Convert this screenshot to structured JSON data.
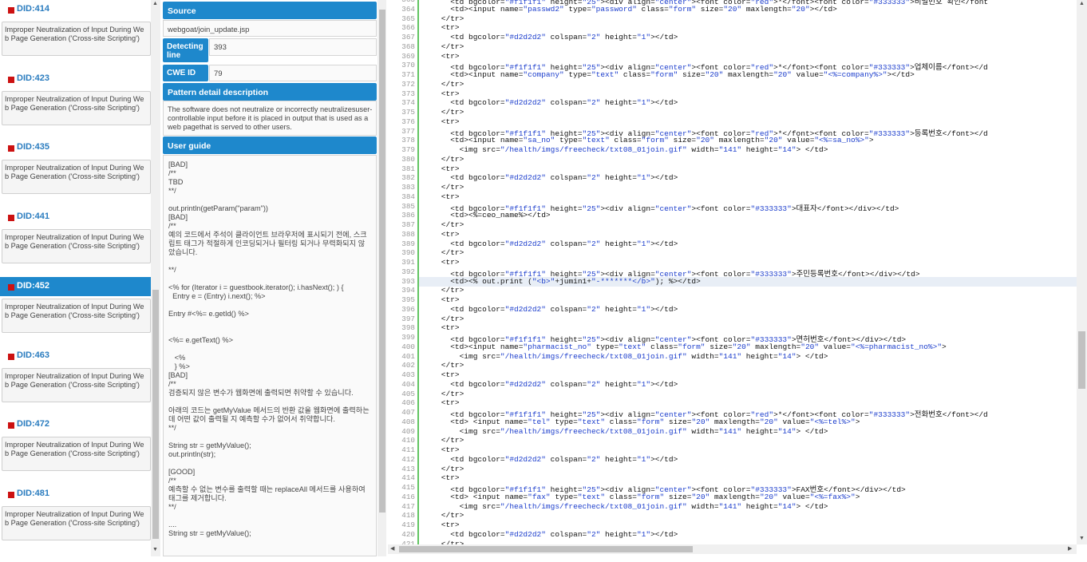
{
  "issues": [
    {
      "id": "DID:414",
      "text": "Improper Neutralization of Input During Web Page Generation ('Cross-site Scripting')",
      "selected": false
    },
    {
      "id": "DID:423",
      "text": "Improper Neutralization of Input During Web Page Generation ('Cross-site Scripting')",
      "selected": false
    },
    {
      "id": "DID:435",
      "text": "Improper Neutralization of Input During Web Page Generation ('Cross-site Scripting')",
      "selected": false
    },
    {
      "id": "DID:441",
      "text": "Improper Neutralization of Input During Web Page Generation ('Cross-site Scripting')",
      "selected": false
    },
    {
      "id": "DID:452",
      "text": "Improper Neutralization of Input During Web Page Generation ('Cross-site Scripting')",
      "selected": true
    },
    {
      "id": "DID:463",
      "text": "Improper Neutralization of Input During Web Page Generation ('Cross-site Scripting')",
      "selected": false
    },
    {
      "id": "DID:472",
      "text": "Improper Neutralization of Input During Web Page Generation ('Cross-site Scripting')",
      "selected": false
    },
    {
      "id": "DID:481",
      "text": "Improper Neutralization of Input During Web Page Generation ('Cross-site Scripting')",
      "selected": false
    }
  ],
  "detail": {
    "source_label": "Source",
    "source_value": "webgoat/join_update.jsp",
    "detecting_line_label": "Detecting line",
    "detecting_line_value": "393",
    "cwe_label": "CWE ID",
    "cwe_value": "79",
    "pattern_label": "Pattern detail description",
    "pattern_text": "The software does not neutralize or incorrectly neutralizesuser-controllable input before it is placed in output that is used as a web pagethat is served to other users.",
    "guide_label": "User guide",
    "guide_text": "[BAD]\n/**\nTBD\n**/\n\nout.println(getParam(\"param\"))\n[BAD]\n/**\n예의 코드에서 주석이 클라이언트 브라우저에 표시되기 전에, 스크립트 태그가 적절하게 인코딩되거나 필터링 되거나 무력화되지 않았습니다.\n\n**/\n\n<% for (Iterator i = guestbook.iterator(); i.hasNext(); ) {\n  Entry e = (Entry) i.next(); %>\n\nEntry #<%= e.getId() %>\n\n\n<%= e.getText() %>\n\n   <%\n   } %>\n[BAD]\n/**\n검증되지 않은 변수가 웹화면에 출력되면 취약할 수 있습니다.\n\n아래의 코드는 getMyValue 메서드의 반환 값을 웹화면에 출력하는데 어떤 값이 출력될 지 예측할 수가 없어서 취약합니다.\n**/\n\nString str = getMyValue();\nout.println(str);\n\n[GOOD]\n/**\n예측할 수 없는 변수를 출력할 때는 replaceAll 메서드를 사용하여 태그를 제거합니다.\n**/\n\n....\nString str = getMyValue();"
  },
  "editor": {
    "highlight_line": 393,
    "lines": [
      {
        "n": "363",
        "t": "      <td bgcolor=\"#f1f1f1\" height=\"25\"><div align=\"center\"><font color=\"red\">*</font><font color=\"#333333\">비밀번호 확인</font"
      },
      {
        "n": "364",
        "t": "      <td><input name=\"passwd2\" type=\"password\" class=\"form\" size=\"20\" maxlength=\"20\"></td>"
      },
      {
        "n": "365",
        "t": "    </tr>"
      },
      {
        "n": "366",
        "t": "    <tr>"
      },
      {
        "n": "367",
        "t": "      <td bgcolor=\"#d2d2d2\" colspan=\"2\" height=\"1\"></td>"
      },
      {
        "n": "368",
        "t": "    </tr>"
      },
      {
        "n": "369",
        "t": "    <tr>"
      },
      {
        "n": "370",
        "t": "      <td bgcolor=\"#f1f1f1\" height=\"25\"><div align=\"center\"><font color=\"red\">*</font><font color=\"#333333\">업체이름</font></d"
      },
      {
        "n": "371",
        "t": "      <td><input name=\"company\" type=\"text\" class=\"form\" size=\"20\" maxlength=\"20\" value=\"<%=company%>\"></td>"
      },
      {
        "n": "372",
        "t": "    </tr>"
      },
      {
        "n": "373",
        "t": "    <tr>"
      },
      {
        "n": "374",
        "t": "      <td bgcolor=\"#d2d2d2\" colspan=\"2\" height=\"1\"></td>"
      },
      {
        "n": "375",
        "t": "    </tr>"
      },
      {
        "n": "376",
        "t": "    <tr>"
      },
      {
        "n": "377",
        "t": "      <td bgcolor=\"#f1f1f1\" height=\"25\"><div align=\"center\"><font color=\"red\">*</font><font color=\"#333333\">등록번호</font></d"
      },
      {
        "n": "378",
        "t": "      <td><input name=\"sa_no\" type=\"text\" class=\"form\" size=\"20\" maxlength=\"20\" value=\"<%=sa_no%>\">"
      },
      {
        "n": "379",
        "t": "        <img src=\"/health/imgs/freecheck/txt08_01join.gif\" width=\"141\" height=\"14\"> </td>"
      },
      {
        "n": "380",
        "t": "    </tr>"
      },
      {
        "n": "381",
        "t": "    <tr>"
      },
      {
        "n": "382",
        "t": "      <td bgcolor=\"#d2d2d2\" colspan=\"2\" height=\"1\"></td>"
      },
      {
        "n": "383",
        "t": "    </tr>"
      },
      {
        "n": "384",
        "t": "    <tr>"
      },
      {
        "n": "385",
        "t": "      <td bgcolor=\"#f1f1f1\" height=\"25\"><div align=\"center\"><font color=\"#333333\">대표자</font></div></td>"
      },
      {
        "n": "386",
        "t": "      <td><%=ceo_name%></td>"
      },
      {
        "n": "387",
        "t": "    </tr>"
      },
      {
        "n": "388",
        "t": "    <tr>"
      },
      {
        "n": "389",
        "t": "      <td bgcolor=\"#d2d2d2\" colspan=\"2\" height=\"1\"></td>"
      },
      {
        "n": "390",
        "t": "    </tr>"
      },
      {
        "n": "391",
        "t": "    <tr>"
      },
      {
        "n": "392",
        "t": "      <td bgcolor=\"#f1f1f1\" height=\"25\"><div align=\"center\"><font color=\"#333333\">주민등록번호</font></div></td>"
      },
      {
        "n": "393",
        "t": "      <td><% out.print (\"<b>\"+jumin1+\"-*******</b>\"); %></td>"
      },
      {
        "n": "394",
        "t": "    </tr>"
      },
      {
        "n": "395",
        "t": "    <tr>"
      },
      {
        "n": "396",
        "t": "      <td bgcolor=\"#d2d2d2\" colspan=\"2\" height=\"1\"></td>"
      },
      {
        "n": "397",
        "t": "    </tr>"
      },
      {
        "n": "398",
        "t": "    <tr>"
      },
      {
        "n": "399",
        "t": "      <td bgcolor=\"#f1f1f1\" height=\"25\"><div align=\"center\"><font color=\"#333333\">면허번호</font></div></td>"
      },
      {
        "n": "400",
        "t": "      <td><input name=\"pharmacist_no\" type=\"text\" class=\"form\" size=\"20\" maxlength=\"20\" value=\"<%=pharmacist_no%>\">"
      },
      {
        "n": "401",
        "t": "        <img src=\"/health/imgs/freecheck/txt08_01join.gif\" width=\"141\" height=\"14\"> </td>"
      },
      {
        "n": "402",
        "t": "    </tr>"
      },
      {
        "n": "403",
        "t": "    <tr>"
      },
      {
        "n": "404",
        "t": "      <td bgcolor=\"#d2d2d2\" colspan=\"2\" height=\"1\"></td>"
      },
      {
        "n": "405",
        "t": "    </tr>"
      },
      {
        "n": "406",
        "t": "    <tr>"
      },
      {
        "n": "407",
        "t": "      <td bgcolor=\"#f1f1f1\" height=\"25\"><div align=\"center\"><font color=\"red\">*</font><font color=\"#333333\">전화번호</font></d"
      },
      {
        "n": "408",
        "t": "      <td> <input name=\"tel\" type=\"text\" class=\"form\" size=\"20\" maxlength=\"20\" value=\"<%=tel%>\">"
      },
      {
        "n": "409",
        "t": "        <img src=\"/health/imgs/freecheck/txt08_01join.gif\" width=\"141\" height=\"14\"> </td>"
      },
      {
        "n": "410",
        "t": "    </tr>"
      },
      {
        "n": "411",
        "t": "    <tr>"
      },
      {
        "n": "412",
        "t": "      <td bgcolor=\"#d2d2d2\" colspan=\"2\" height=\"1\"></td>"
      },
      {
        "n": "413",
        "t": "    </tr>"
      },
      {
        "n": "414",
        "t": "    <tr>"
      },
      {
        "n": "415",
        "t": "      <td bgcolor=\"#f1f1f1\" height=\"25\"><div align=\"center\"><font color=\"#333333\">FAX번호</font></div></td>"
      },
      {
        "n": "416",
        "t": "      <td> <input name=\"fax\" type=\"text\" class=\"form\" size=\"20\" maxlength=\"20\" value=\"<%=fax%>\">"
      },
      {
        "n": "417",
        "t": "        <img src=\"/health/imgs/freecheck/txt08_01join.gif\" width=\"141\" height=\"14\"> </td>"
      },
      {
        "n": "418",
        "t": "    </tr>"
      },
      {
        "n": "419",
        "t": "    <tr>"
      },
      {
        "n": "420",
        "t": "      <td bgcolor=\"#d2d2d2\" colspan=\"2\" height=\"1\"></td>"
      },
      {
        "n": "421",
        "t": "    </tr>"
      }
    ]
  },
  "colors": {
    "accent": "#1e88cc",
    "issue_marker": "#cc1111",
    "line_highlight": "#e8eef6",
    "fold_marker": "#62c462",
    "string_literal": "#1a3ccc"
  }
}
